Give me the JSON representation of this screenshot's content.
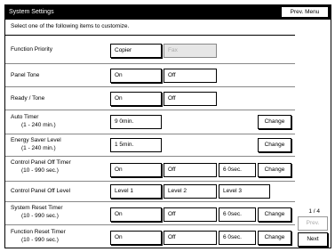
{
  "header": {
    "title": "System Settings",
    "prev_menu_label": "Prev. Menu",
    "instruction": "Select one of the following items to customize."
  },
  "rows": [
    {
      "label": "Function Priority",
      "options": [
        {
          "label": "Copier",
          "selected": true
        },
        {
          "label": "Fax",
          "disabled": true
        }
      ]
    },
    {
      "label": "Panel Tone",
      "options": [
        {
          "label": "On",
          "selected": true
        },
        {
          "label": "Off"
        }
      ]
    },
    {
      "label": "Ready / Tone",
      "options": [
        {
          "label": "On",
          "selected": true
        },
        {
          "label": "Off"
        }
      ]
    },
    {
      "label": "Auto Timer",
      "sub": "(1 - 240 min.)",
      "value": "9 0min.",
      "change_label": "Change"
    },
    {
      "label": "Energy Saver Level",
      "sub": "(1 - 240 min.)",
      "value": "1 5min.",
      "change_label": "Change"
    },
    {
      "label": "Control Panel Off Timer",
      "sub": "(10 - 990 sec.)",
      "options": [
        {
          "label": "On",
          "selected": true
        },
        {
          "label": "Off"
        }
      ],
      "value": "6 0sec.",
      "change_label": "Change"
    },
    {
      "label": "Control Panel Off Level",
      "options": [
        {
          "label": "Level 1",
          "selected": true
        },
        {
          "label": "Level 2"
        },
        {
          "label": "Level 3"
        }
      ]
    },
    {
      "label": "System Reset Timer",
      "sub": "(10 - 990 sec.)",
      "options": [
        {
          "label": "On",
          "selected": true
        },
        {
          "label": "Off"
        }
      ],
      "value": "6 0sec.",
      "change_label": "Change"
    },
    {
      "label": "Function Reset Timer",
      "sub": "(10 - 990 sec.)",
      "options": [
        {
          "label": "On",
          "selected": true
        },
        {
          "label": "Off"
        }
      ],
      "value": "6 0sec.",
      "change_label": "Change"
    }
  ],
  "pagination": {
    "page": "1 / 4",
    "prev_label": "Prev.",
    "next_label": "Next"
  }
}
